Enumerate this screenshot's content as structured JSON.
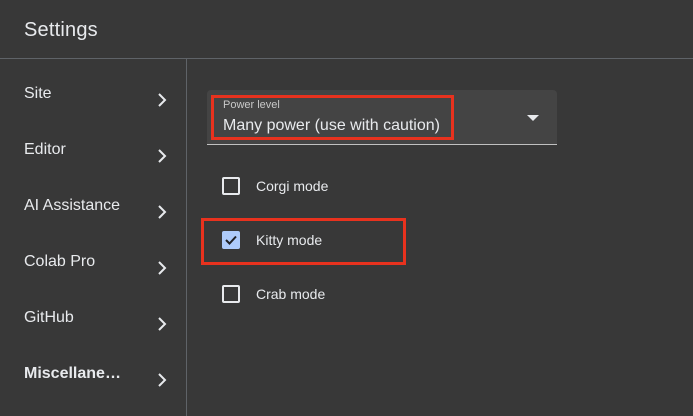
{
  "header": {
    "title": "Settings"
  },
  "sidebar": {
    "items": [
      {
        "label": "Site"
      },
      {
        "label": "Editor"
      },
      {
        "label": "AI Assistance"
      },
      {
        "label": "Colab Pro"
      },
      {
        "label": "GitHub"
      },
      {
        "label": "Miscellaneous",
        "active": true
      }
    ]
  },
  "main": {
    "power_level": {
      "label": "Power level",
      "value": "Many power (use with caution)"
    },
    "checkboxes": [
      {
        "label": "Corgi mode",
        "checked": false
      },
      {
        "label": "Kitty mode",
        "checked": true
      },
      {
        "label": "Crab mode",
        "checked": false
      }
    ]
  },
  "colors": {
    "background": "#383838",
    "divider": "#5f6368",
    "checkbox_checked": "#aecbfa",
    "highlight": "#e8321e"
  }
}
